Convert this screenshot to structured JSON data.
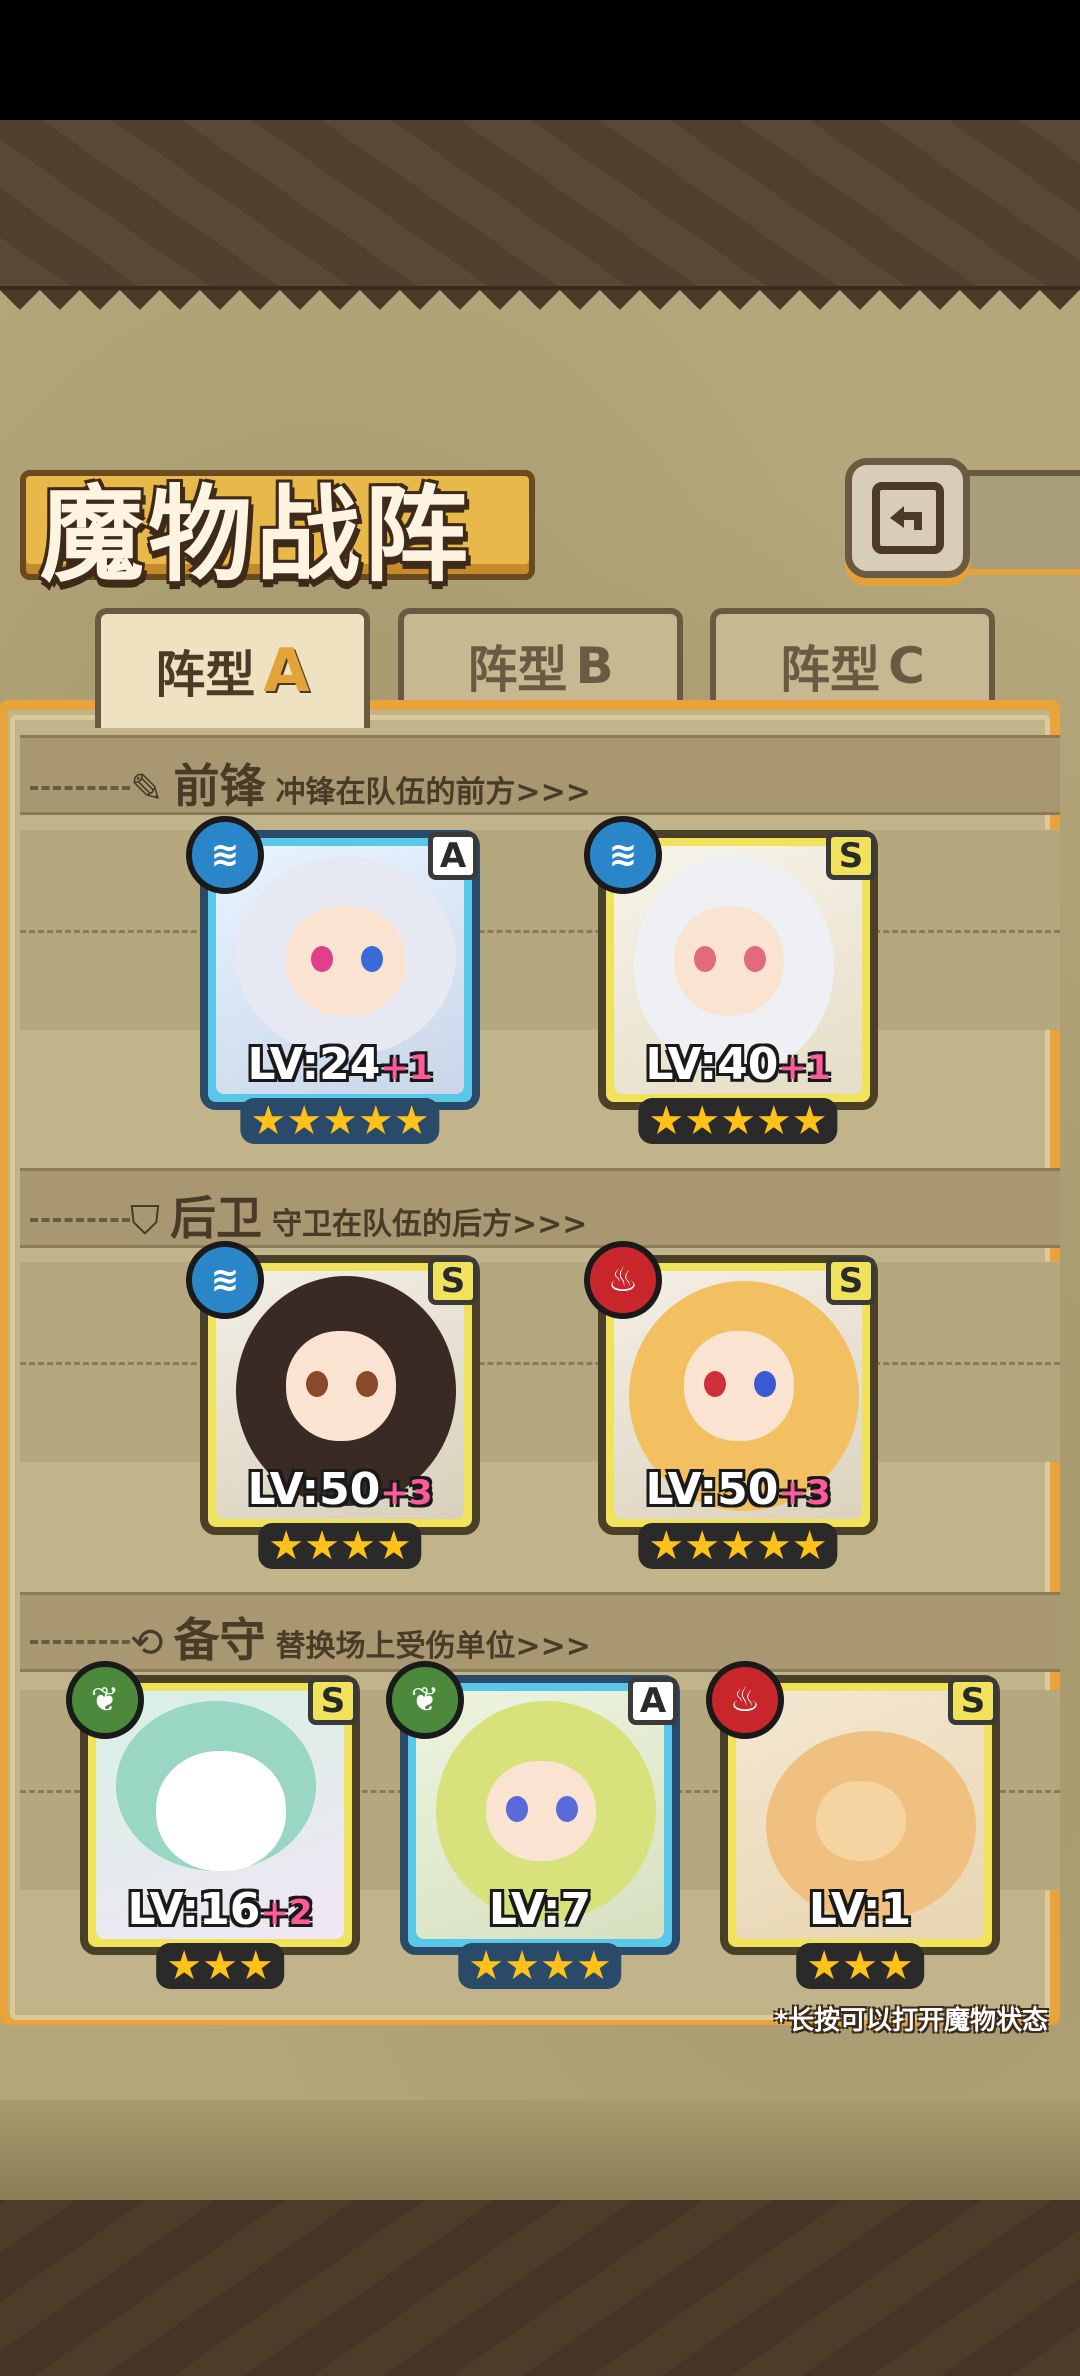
{
  "title": "魔物战阵",
  "tabs": [
    {
      "label": "阵型",
      "letter": "A",
      "selected": true
    },
    {
      "label": "阵型",
      "letter": "B",
      "selected": false
    },
    {
      "label": "阵型",
      "letter": "C",
      "selected": false
    }
  ],
  "sections": {
    "front": {
      "title": "前锋",
      "subtitle": "冲锋在队伍的前方>>>",
      "icon": "sword-icon"
    },
    "back": {
      "title": "后卫",
      "subtitle": "守卫在队伍的后方>>>",
      "icon": "shield-icon"
    },
    "reserve": {
      "title": "备守",
      "subtitle": "替换场上受伤单位>>>",
      "icon": "swap-icon"
    }
  },
  "monsters": {
    "front": [
      {
        "rank": "A",
        "element": "water",
        "level": "LV:24",
        "bonus": "+1",
        "stars": "★★★★★"
      },
      {
        "rank": "S",
        "element": "water",
        "level": "LV:40",
        "bonus": "+1",
        "stars": "★★★★★"
      }
    ],
    "back": [
      {
        "rank": "S",
        "element": "water",
        "level": "LV:50",
        "bonus": "+3",
        "stars": "★★★★"
      },
      {
        "rank": "S",
        "element": "fire",
        "level": "LV:50",
        "bonus": "+3",
        "stars": "★★★★★"
      }
    ],
    "reserve": [
      {
        "rank": "S",
        "element": "leaf",
        "level": "LV:16",
        "bonus": "+2",
        "stars": "★★★"
      },
      {
        "rank": "A",
        "element": "leaf",
        "level": "LV:7",
        "bonus": "",
        "stars": "★★★★"
      },
      {
        "rank": "S",
        "element": "fire",
        "level": "LV:1",
        "bonus": "",
        "stars": "★★★"
      }
    ]
  },
  "footnote": "*长按可以打开魔物状态",
  "colors": {
    "accent": "#e8a43a",
    "water": "#2a86c8",
    "fire": "#c8262a",
    "leaf": "#4a8a3a",
    "rank_a": "#59c8e8",
    "rank_s": "#f0e25a"
  }
}
